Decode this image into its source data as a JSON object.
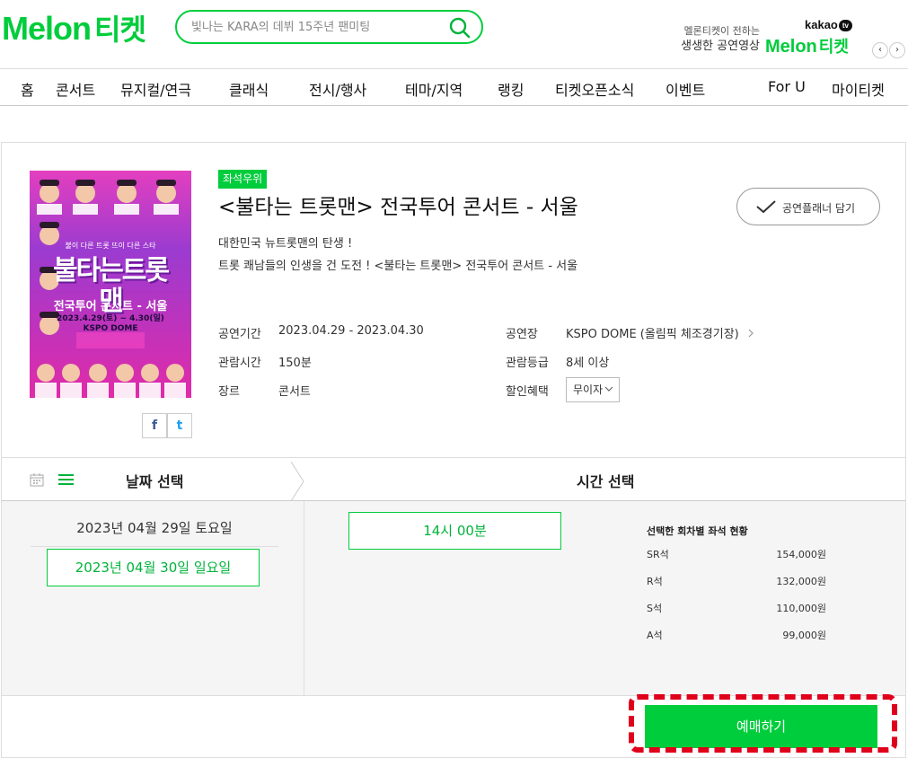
{
  "header": {
    "logo_text": "Melon",
    "logo_ticket": "티켓",
    "search_placeholder": "빛나는 KARA의 데뷔 15주년 팬미팅",
    "promo_line1": "멜론티켓이 전하는",
    "promo_line2": "생생한 공연영상",
    "kakao": "kakao",
    "tv": "tv",
    "promo_logo": "Melon",
    "promo_ticket": "티켓",
    "prev": "‹",
    "next": "›"
  },
  "nav": {
    "items": [
      "홈",
      "콘서트",
      "뮤지컬/연극",
      "클래식",
      "전시/행사",
      "테마/지역",
      "랭킹",
      "티켓오픈소식",
      "이벤트",
      "For U",
      "마이티켓"
    ]
  },
  "product": {
    "badge": "좌석우위",
    "title": "<불타는 트롯맨> 전국투어 콘서트 - 서울",
    "planner_label": "공연플래너 담기",
    "desc_line1": "대한민국 뉴트롯맨의 탄생 !",
    "desc_line2": "트롯 쾌남들의 인생을 건 도전 ! <불타는 트롯맨> 전국투어 콘서트 - 서울",
    "poster": {
      "top": "불이 다른 트롯 뜨이 다른 스타",
      "title": "불타는트롯맨",
      "sub": "전국투어 콘서트 - 서울",
      "date": "2023.4.29(토) ~ 4.30(일)",
      "venue": "KSPO DOME"
    },
    "share_facebook": "f",
    "share_twitter": "t",
    "info": {
      "period_label": "공연기간",
      "period": "2023.04.29 - 2023.04.30",
      "venue_label": "공연장",
      "venue": "KSPO DOME (올림픽 체조경기장)",
      "runtime_label": "관람시간",
      "runtime": "150분",
      "rating_label": "관람등급",
      "rating": "8세 이상",
      "genre_label": "장르",
      "genre": "콘서트",
      "discount_label": "할인혜택",
      "discount": "무이자"
    }
  },
  "booking": {
    "date_header": "날짜 선택",
    "time_header": "시간 선택",
    "dates": [
      "2023년 04월 29일 토요일",
      "2023년 04월 30일 일요일"
    ],
    "times": [
      "14시 00분"
    ],
    "seat_title": "선택한 회차별 좌석 현황",
    "seats": [
      {
        "grade": "SR석",
        "price": "154,000원"
      },
      {
        "grade": "R석",
        "price": "132,000원"
      },
      {
        "grade": "S석",
        "price": "110,000원"
      },
      {
        "grade": "A석",
        "price": "99,000원"
      }
    ],
    "reserve_label": "예매하기"
  },
  "colors": {
    "accent": "#00cd3c",
    "highlight": "#e0001b"
  }
}
